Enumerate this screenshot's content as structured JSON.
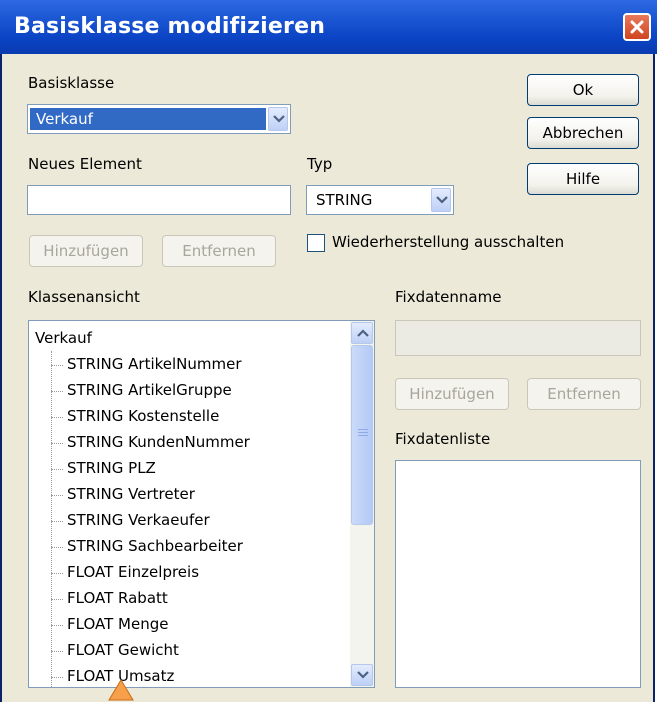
{
  "window": {
    "title": "Basisklasse modifizieren",
    "colors": {
      "titlebar": "#0b44c4",
      "dialog_bg": "#ece9d8",
      "selection": "#316ac5",
      "close": "#d0451f"
    }
  },
  "buttons": {
    "ok": "Ok",
    "abbrechen": "Abbrechen",
    "hilfe": "Hilfe",
    "hinzufuegen": "Hinzufügen",
    "entfernen": "Entfernen",
    "fix_hinzufuegen": "Hinzufügen",
    "fix_entfernen": "Entfernen"
  },
  "basisklasse": {
    "label": "Basisklasse",
    "selected": "Verkauf"
  },
  "neues_element": {
    "label": "Neues Element",
    "value": ""
  },
  "typ": {
    "label": "Typ",
    "selected": "STRING"
  },
  "checkbox": {
    "label": "Wiederherstellung ausschalten",
    "checked": false
  },
  "klassenansicht": {
    "label": "Klassenansicht",
    "root": "Verkauf",
    "items": [
      "STRING ArtikelNummer",
      "STRING ArtikelGruppe",
      "STRING Kostenstelle",
      "STRING KundenNummer",
      "STRING PLZ",
      "STRING Vertreter",
      "STRING Verkaeufer",
      "STRING Sachbearbeiter",
      "FLOAT Einzelpreis",
      "FLOAT Rabatt",
      "FLOAT Menge",
      "FLOAT Gewicht",
      "FLOAT Umsatz"
    ]
  },
  "fixdaten": {
    "name_label": "Fixdatenname",
    "name_value": "",
    "list_label": "Fixdatenliste"
  },
  "icons": {
    "close": "close-icon",
    "dropdown": "chevron-down-icon",
    "scroll_up": "arrow-up-icon",
    "scroll_down": "arrow-down-icon",
    "cursor": "mouse-cursor-icon"
  }
}
